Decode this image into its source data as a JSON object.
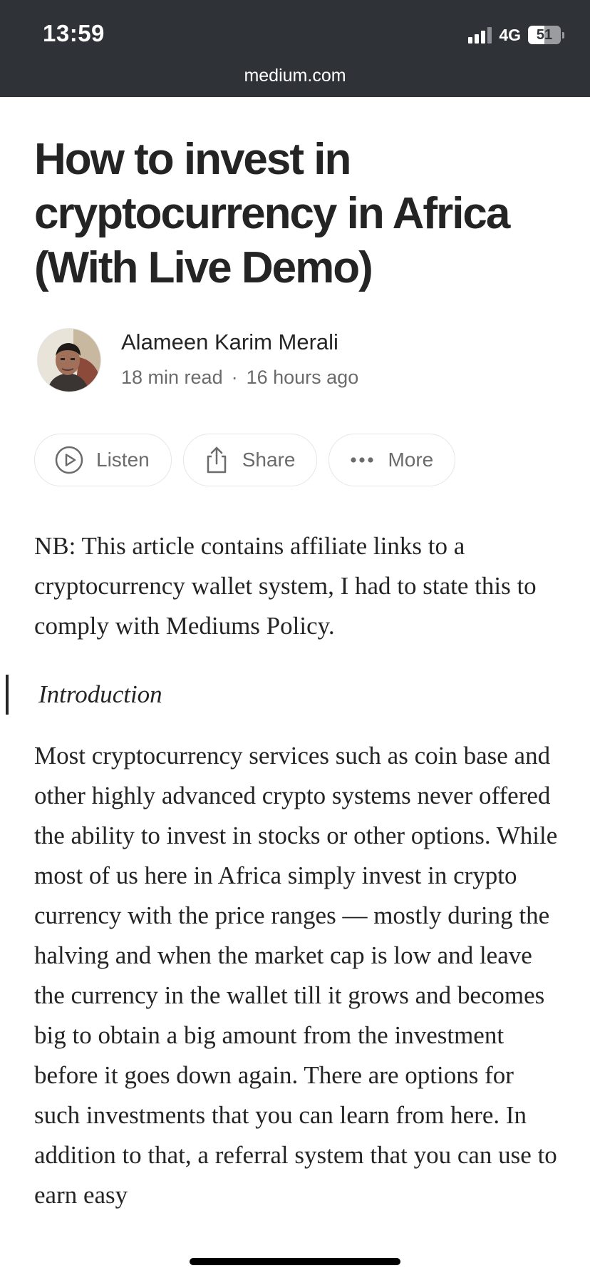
{
  "status_bar": {
    "time": "13:59",
    "network": "4G",
    "battery": "51",
    "battery_level_percent": 51,
    "signal_bars_active": 3,
    "signal_bars_total": 4,
    "url": "medium.com",
    "background": "#2f3236"
  },
  "article": {
    "title": "How to invest in cryptocurrency in Africa (With Live Demo)",
    "author": {
      "name": "Alameen Karim Merali",
      "read_time": "18 min read",
      "separator": "·",
      "published": "16 hours ago"
    },
    "actions": [
      {
        "icon": "play-circle-icon",
        "label": "Listen"
      },
      {
        "icon": "share-icon",
        "label": "Share"
      },
      {
        "icon": "more-dots-icon",
        "label": "More"
      }
    ],
    "disclaimer": "NB: This article contains affiliate links to a cryptocurrency wallet system, I had to state this to comply with Mediums Policy.",
    "intro_heading": "Introduction",
    "intro_paragraph": "Most cryptocurrency services such as coin base and other highly advanced crypto systems never offered the ability to invest in stocks or other options. While most of us here in Africa simply invest in crypto currency with the price ranges — mostly during the halving and when the market cap is low and leave the currency in the wallet till it grows and becomes big to obtain a big amount from the investment before it goes down again. There are options for such investments that you can learn from here. In addition to that, a referral system that you can use to earn easy"
  },
  "colors": {
    "text_primary": "#242424",
    "text_secondary": "#6b6b6b",
    "pill_border": "#e6e6e6"
  }
}
